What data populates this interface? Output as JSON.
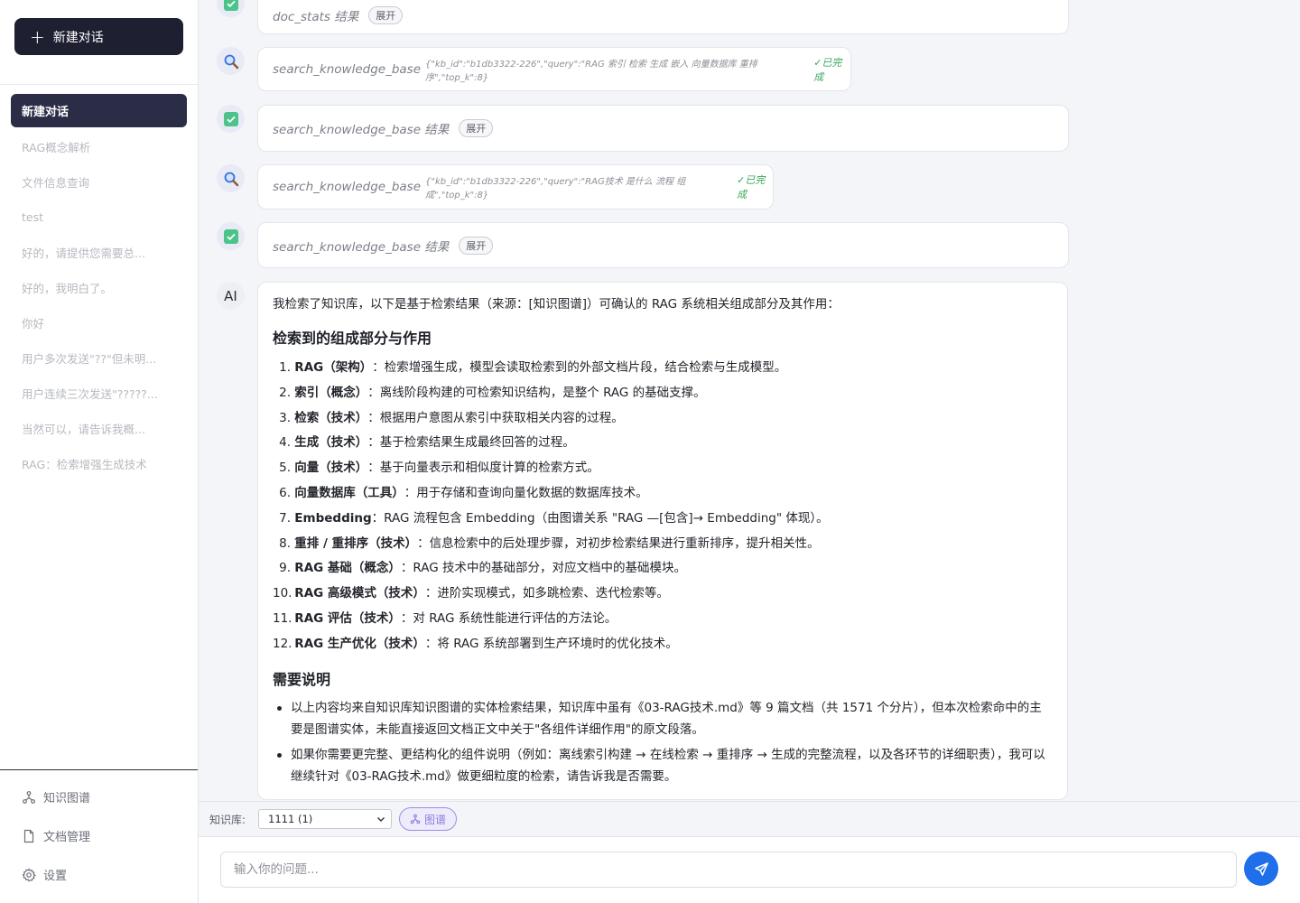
{
  "sidebar": {
    "new_chat_label": "新建对话",
    "conversations": [
      "新建对话",
      "RAG概念解析",
      "文件信息查询",
      "test",
      "好的，请提供您需要总...",
      "好的，我明白了。",
      "你好",
      "用户多次发送\"??\"但未明...",
      "用户连续三次发送\"?????...",
      "当然可以，请告诉我概...",
      "RAG：检索增强生成技术"
    ],
    "nav": {
      "knowledge_graph": "知识图谱",
      "documents": "文档管理",
      "settings": "设置"
    }
  },
  "messages": {
    "m1": {
      "name": "doc_stats 结果",
      "expand": "展开"
    },
    "m2": {
      "name": "search_knowledge_base",
      "args": "{\"kb_id\":\"b1db3322-226\",\"query\":\"RAG 索引 检索 生成 嵌入 向量数据库 重排序\",\"top_k\":8}",
      "status": "✓已完成"
    },
    "m3": {
      "name": "search_knowledge_base 结果",
      "expand": "展开"
    },
    "m4": {
      "name": "search_knowledge_base",
      "args": "{\"kb_id\":\"b1db3322-226\",\"query\":\"RAG技术 是什么 流程 组成\",\"top_k\":8}",
      "status": "✓已完成"
    },
    "m5": {
      "name": "search_knowledge_base 结果",
      "expand": "展开"
    }
  },
  "ai": {
    "avatar": "AI",
    "intro": "我检索了知识库，以下是基于检索结果（来源：[知识图谱]）可确认的 RAG 系统相关组成部分及其作用：",
    "h1": "检索到的组成部分与作用",
    "items": [
      {
        "num": "1.",
        "term": "RAG（架构）",
        "desc": "：检索增强生成，模型会读取检索到的外部文档片段，结合检索与生成模型。"
      },
      {
        "num": "2.",
        "term": "索引（概念）",
        "desc": "：离线阶段构建的可检索知识结构，是整个 RAG 的基础支撑。"
      },
      {
        "num": "3.",
        "term": "检索（技术）",
        "desc": "：根据用户意图从索引中获取相关内容的过程。"
      },
      {
        "num": "4.",
        "term": "生成（技术）",
        "desc": "：基于检索结果生成最终回答的过程。"
      },
      {
        "num": "5.",
        "term": "向量（技术）",
        "desc": "：基于向量表示和相似度计算的检索方式。"
      },
      {
        "num": "6.",
        "term": "向量数据库（工具）",
        "desc": "：用于存储和查询向量化数据的数据库技术。"
      },
      {
        "num": "7.",
        "term": "Embedding",
        "desc": "：RAG 流程包含 Embedding（由图谱关系 \"RAG —[包含]→ Embedding\" 体现）。"
      },
      {
        "num": "8.",
        "term": "重排 / 重排序（技术）",
        "desc": "：信息检索中的后处理步骤，对初步检索结果进行重新排序，提升相关性。"
      },
      {
        "num": "9.",
        "term": "RAG 基础（概念）",
        "desc": "：RAG 技术中的基础部分，对应文档中的基础模块。"
      },
      {
        "num": "10.",
        "term": "RAG 高级模式（技术）",
        "desc": "：进阶实现模式，如多跳检索、迭代检索等。"
      },
      {
        "num": "11.",
        "term": "RAG 评估（技术）",
        "desc": "：对 RAG 系统性能进行评估的方法论。"
      },
      {
        "num": "12.",
        "term": "RAG 生产优化（技术）",
        "desc": "：将 RAG 系统部署到生产环境时的优化技术。"
      }
    ],
    "h2": "需要说明",
    "notes": [
      "以上内容均来自知识库知识图谱的实体检索结果，知识库中虽有《03-RAG技术.md》等 9 篇文档（共 1571 个分片），但本次检索命中的主要是图谱实体，未能直接返回文档正文中关于\"各组件详细作用\"的原文段落。",
      "如果你需要更完整、更结构化的组件说明（例如：离线索引构建 → 在线检索 → 重排序 → 生成的完整流程，以及各环节的详细职责），我可以继续针对《03-RAG技术.md》做更细粒度的检索，请告诉我是否需要。"
    ]
  },
  "kb": {
    "label": "知识库:",
    "selected": "1111 (1)",
    "graph_button": "图谱"
  },
  "input": {
    "placeholder": "输入你的问题..."
  },
  "colors": {
    "accent": "#1f6feb",
    "sidebar_active": "#2b2d47",
    "success": "#39a55a",
    "graph": "#8a7fe0"
  }
}
